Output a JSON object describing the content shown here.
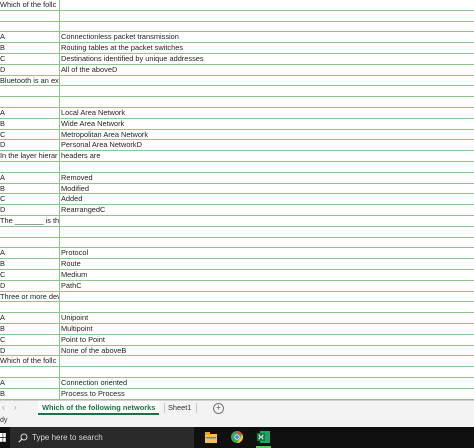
{
  "rows": [
    {
      "a": "Which of the follc",
      "b": ""
    },
    {
      "a": "",
      "b": ""
    },
    {
      "a": "",
      "b": ""
    },
    {
      "a": "A",
      "b": "Connectionless packet transmission"
    },
    {
      "a": "B",
      "b": "Routing tables at the packet switches"
    },
    {
      "a": "C",
      "b": "Destinations identified by unique addresses"
    },
    {
      "a": "D",
      "b": "All of the aboveD"
    },
    {
      "a": "Bluetooth is an ex",
      "b": ""
    },
    {
      "a": "",
      "b": ""
    },
    {
      "a": "",
      "b": ""
    },
    {
      "a": "A",
      "b": "Local Area Network"
    },
    {
      "a": "B",
      "b": "Wide Area Network"
    },
    {
      "a": "C",
      "b": "Metropolitan Area Network"
    },
    {
      "a": "D",
      "b": "Personal Area NetworkD"
    },
    {
      "a": "In the layer hierar",
      "b": "headers are"
    },
    {
      "a": "",
      "b": ""
    },
    {
      "a": "A",
      "b": "Removed"
    },
    {
      "a": "B",
      "b": "Modified"
    },
    {
      "a": "C",
      "b": "Added"
    },
    {
      "a": "D",
      "b": "RearrangedC"
    },
    {
      "a": "The _______ is th",
      "b": ""
    },
    {
      "a": "",
      "b": ""
    },
    {
      "a": "",
      "b": ""
    },
    {
      "a": "A",
      "b": "Protocol"
    },
    {
      "a": "B",
      "b": "Route"
    },
    {
      "a": "C",
      "b": "Medium"
    },
    {
      "a": "D",
      "b": "PathC"
    },
    {
      "a": "Three or more dev",
      "b": ""
    },
    {
      "a": "",
      "b": ""
    },
    {
      "a": "A",
      "b": "Unipoint"
    },
    {
      "a": "B",
      "b": "Multipoint"
    },
    {
      "a": "C",
      "b": "Point to Point"
    },
    {
      "a": "D",
      "b": "None of the aboveB"
    },
    {
      "a": "Which of the follc",
      "b": ""
    },
    {
      "a": "",
      "b": ""
    },
    {
      "a": "A",
      "b": "Connection oriented"
    },
    {
      "a": "B",
      "b": "Process to Process"
    }
  ],
  "sheet_tabs": {
    "nav_prev": "‹",
    "nav_next": "›",
    "active": "Which of the following networks",
    "other": "Sheet1",
    "add": "+"
  },
  "status": {
    "text": "dy"
  },
  "taskbar": {
    "search_placeholder": "Type here to search",
    "icons": [
      "windows-start-icon",
      "search-icon",
      "file-explorer-icon",
      "chrome-icon",
      "excel-icon"
    ]
  },
  "colors": {
    "grid_line": "#8cc68c",
    "tab_accent": "#1e7145"
  }
}
